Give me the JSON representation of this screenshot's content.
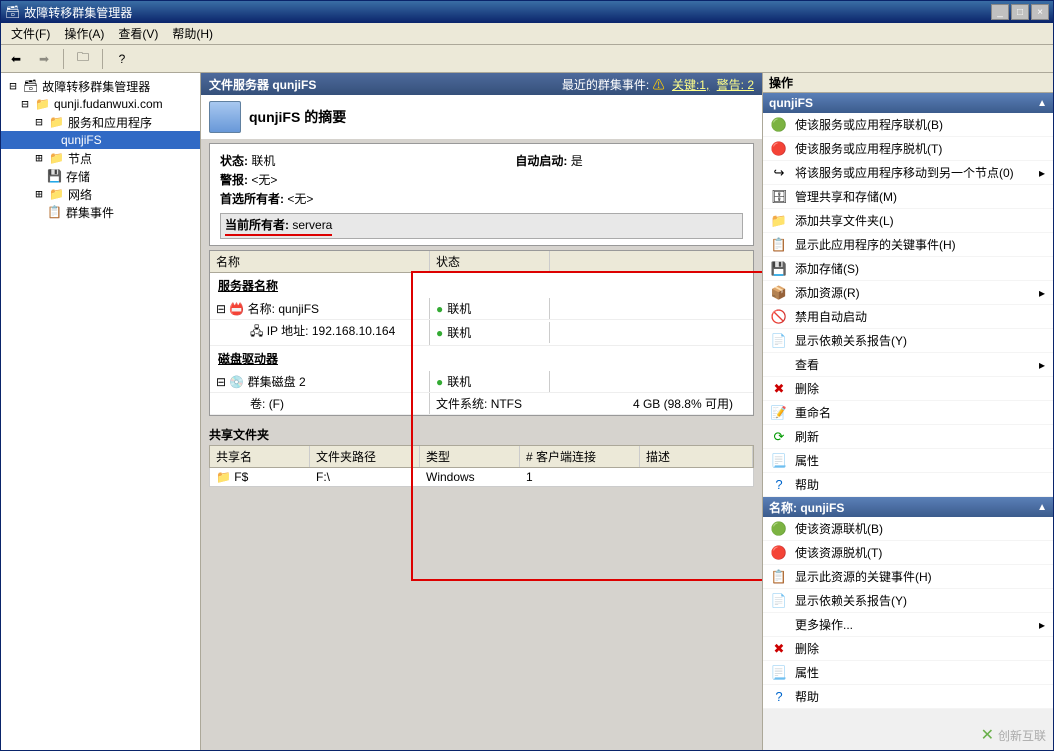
{
  "window": {
    "title": "故障转移群集管理器"
  },
  "menu": {
    "file": "文件(F)",
    "action": "操作(A)",
    "view": "查看(V)",
    "help": "帮助(H)"
  },
  "tree": {
    "root": "故障转移群集管理器",
    "cluster": "qunji.fudanwuxi.com",
    "services_apps": "服务和应用程序",
    "qunjifs": "qunjiFS",
    "nodes": "节点",
    "storage": "存储",
    "networks": "网络",
    "events": "群集事件"
  },
  "center": {
    "header_title": "文件服务器 qunjiFS",
    "recent_events_label": "最近的群集事件:",
    "critical_link": "关键:1,",
    "warning_link": "警告: 2",
    "summary_title": "qunjiFS 的摘要",
    "status_label": "状态:",
    "status_value": "联机",
    "autostart_label": "自动启动:",
    "autostart_value": "是",
    "alerts_label": "警报:",
    "alerts_value": "<无>",
    "preferred_label": "首选所有者:",
    "preferred_value": "<无>",
    "current_label": "当前所有者:",
    "current_value": "servera",
    "cols": {
      "name": "名称",
      "status": "状态"
    },
    "group_servername": "服务器名称",
    "res_name_label": "名称:",
    "res_name_value": "qunjiFS",
    "res_name_status": "联机",
    "res_ip_label": "IP 地址:",
    "res_ip_value": "192.168.10.164",
    "res_ip_status": "联机",
    "group_disk": "磁盘驱动器",
    "disk_name": "群集磁盘 2",
    "disk_status": "联机",
    "volume_label": "卷:",
    "volume_value": "(F)",
    "fs_label": "文件系统:",
    "fs_value": "NTFS",
    "capacity": "4 GB (98.8% 可用)",
    "share_section": "共享文件夹",
    "share_cols": {
      "name": "共享名",
      "path": "文件夹路径",
      "type": "类型",
      "clients": "# 客户端连接",
      "desc": "描述"
    },
    "share_row": {
      "name": "F$",
      "path": "F:\\",
      "type": "Windows",
      "clients": "1",
      "desc": ""
    }
  },
  "right": {
    "pane_title": "操作",
    "section1_title": "qunjiFS",
    "section2_title": "名称: qunjiFS",
    "actions1": [
      "使该服务或应用程序联机(B)",
      "使该服务或应用程序脱机(T)",
      "将该服务或应用程序移动到另一个节点(0)",
      "管理共享和存储(M)",
      "添加共享文件夹(L)",
      "显示此应用程序的关键事件(H)",
      "添加存储(S)",
      "添加资源(R)",
      "禁用自动启动",
      "显示依赖关系报告(Y)",
      "查看",
      "删除",
      "重命名",
      "刷新",
      "属性",
      "帮助"
    ],
    "actions2": [
      "使该资源联机(B)",
      "使该资源脱机(T)",
      "显示此资源的关键事件(H)",
      "显示依赖关系报告(Y)",
      "更多操作...",
      "删除",
      "属性",
      "帮助"
    ]
  },
  "watermark": "创新互联"
}
